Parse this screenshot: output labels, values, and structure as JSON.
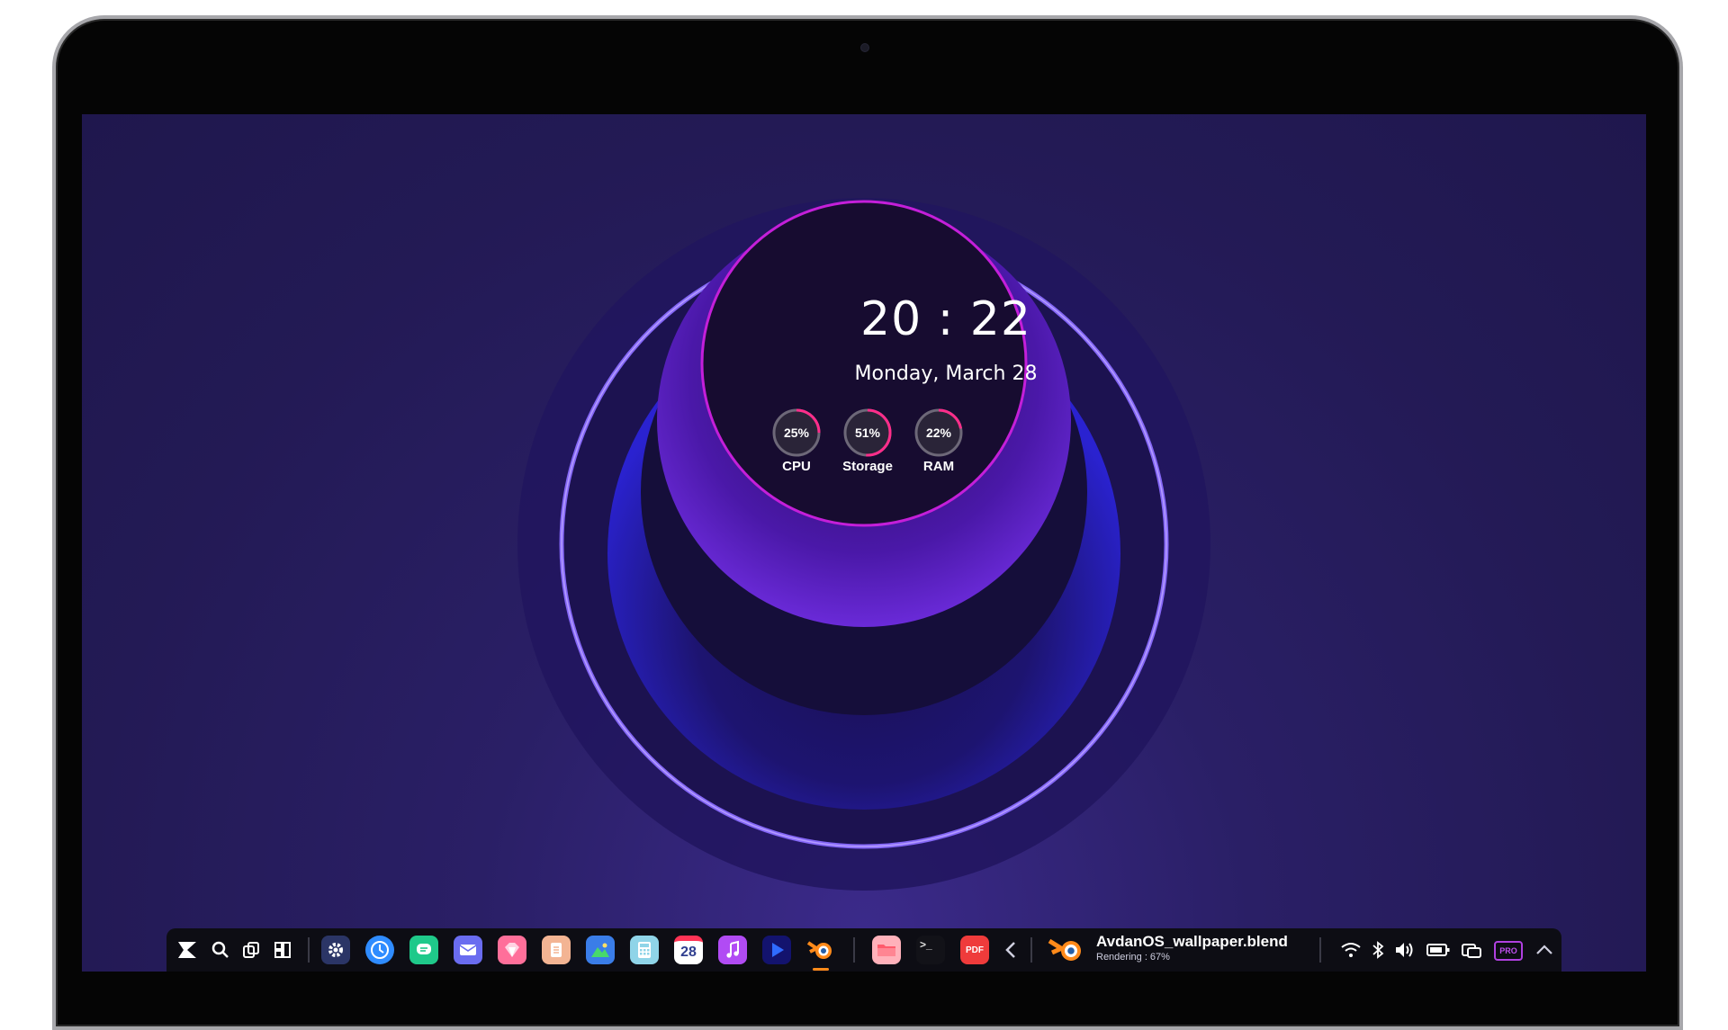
{
  "widget": {
    "time": "20 : 22",
    "date": "Monday, March 28",
    "gauges": [
      {
        "label": "CPU",
        "value_text": "25%",
        "value": 0.25
      },
      {
        "label": "Storage",
        "value_text": "51%",
        "value": 0.51
      },
      {
        "label": "RAM",
        "value_text": "22%",
        "value": 0.22
      }
    ]
  },
  "taskbar": {
    "calendar_day": "28",
    "pdf_label": "PDF",
    "terminal_prompt": ">_",
    "active_task": {
      "title": "AvdanOS_wallpaper.blend",
      "status": "Rendering :  67%"
    },
    "pro_badge": "PRO",
    "apps": [
      "settings-icon",
      "clock-app-icon",
      "messages-icon",
      "mail-icon",
      "browser-icon",
      "notes-icon",
      "photos-icon",
      "calculator-icon",
      "calendar-icon",
      "music-icon",
      "video-player-icon",
      "blender-icon",
      "files-icon",
      "terminal-icon",
      "pdf-icon"
    ]
  },
  "colors": {
    "gauge_accent": "#ff2d8a",
    "ring_glow": "#8a6cff",
    "inner_circle": "#160d2e"
  }
}
